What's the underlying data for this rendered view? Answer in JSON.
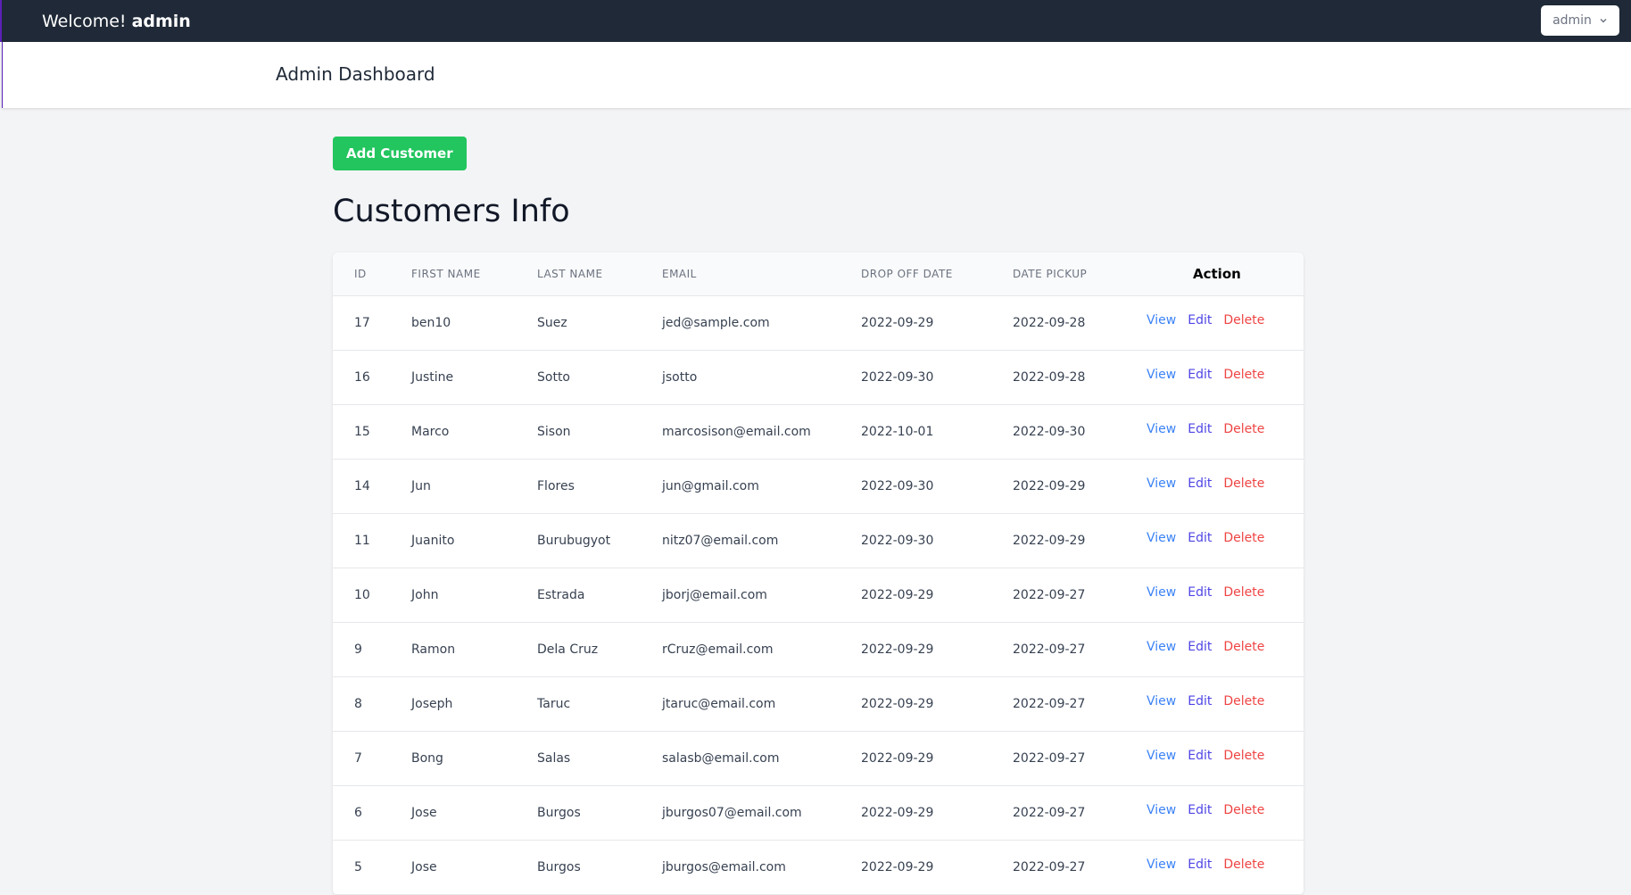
{
  "topbar": {
    "welcome_prefix": "Welcome!",
    "welcome_user": "admin",
    "user_menu_label": "admin"
  },
  "header": {
    "title": "Admin Dashboard"
  },
  "main": {
    "add_button_label": "Add Customer",
    "page_title": "Customers Info"
  },
  "table": {
    "columns": [
      "ID",
      "FIRST NAME",
      "LAST NAME",
      "EMAIL",
      "DROP OFF DATE",
      "DATE PICKUP",
      "Action"
    ],
    "action_labels": {
      "view": "View",
      "edit": "Edit",
      "delete": "Delete"
    },
    "rows": [
      {
        "id": "17",
        "first": "ben10",
        "last": "Suez",
        "email": "jed@sample.com",
        "dropoff": "2022-09-29",
        "pickup": "2022-09-28"
      },
      {
        "id": "16",
        "first": "Justine",
        "last": "Sotto",
        "email": "jsotto",
        "dropoff": "2022-09-30",
        "pickup": "2022-09-28"
      },
      {
        "id": "15",
        "first": "Marco",
        "last": "Sison",
        "email": "marcosison@email.com",
        "dropoff": "2022-10-01",
        "pickup": "2022-09-30"
      },
      {
        "id": "14",
        "first": "Jun",
        "last": "Flores",
        "email": "jun@gmail.com",
        "dropoff": "2022-09-30",
        "pickup": "2022-09-29"
      },
      {
        "id": "11",
        "first": "Juanito",
        "last": "Burubugyot",
        "email": "nitz07@email.com",
        "dropoff": "2022-09-30",
        "pickup": "2022-09-29"
      },
      {
        "id": "10",
        "first": "John",
        "last": "Estrada",
        "email": "jborj@email.com",
        "dropoff": "2022-09-29",
        "pickup": "2022-09-27"
      },
      {
        "id": "9",
        "first": "Ramon",
        "last": "Dela Cruz",
        "email": "rCruz@email.com",
        "dropoff": "2022-09-29",
        "pickup": "2022-09-27"
      },
      {
        "id": "8",
        "first": "Joseph",
        "last": "Taruc",
        "email": "jtaruc@email.com",
        "dropoff": "2022-09-29",
        "pickup": "2022-09-27"
      },
      {
        "id": "7",
        "first": "Bong",
        "last": "Salas",
        "email": "salasb@email.com",
        "dropoff": "2022-09-29",
        "pickup": "2022-09-27"
      },
      {
        "id": "6",
        "first": "Jose",
        "last": "Burgos",
        "email": "jburgos07@email.com",
        "dropoff": "2022-09-29",
        "pickup": "2022-09-27"
      },
      {
        "id": "5",
        "first": "Jose",
        "last": "Burgos",
        "email": "jburgos@email.com",
        "dropoff": "2022-09-29",
        "pickup": "2022-09-27"
      }
    ]
  },
  "colors": {
    "topbar_bg": "#1f2937",
    "add_button_bg": "#22c55e",
    "view_link": "#3b82f6",
    "edit_link": "#4f46e5",
    "delete_link": "#ef4444"
  }
}
